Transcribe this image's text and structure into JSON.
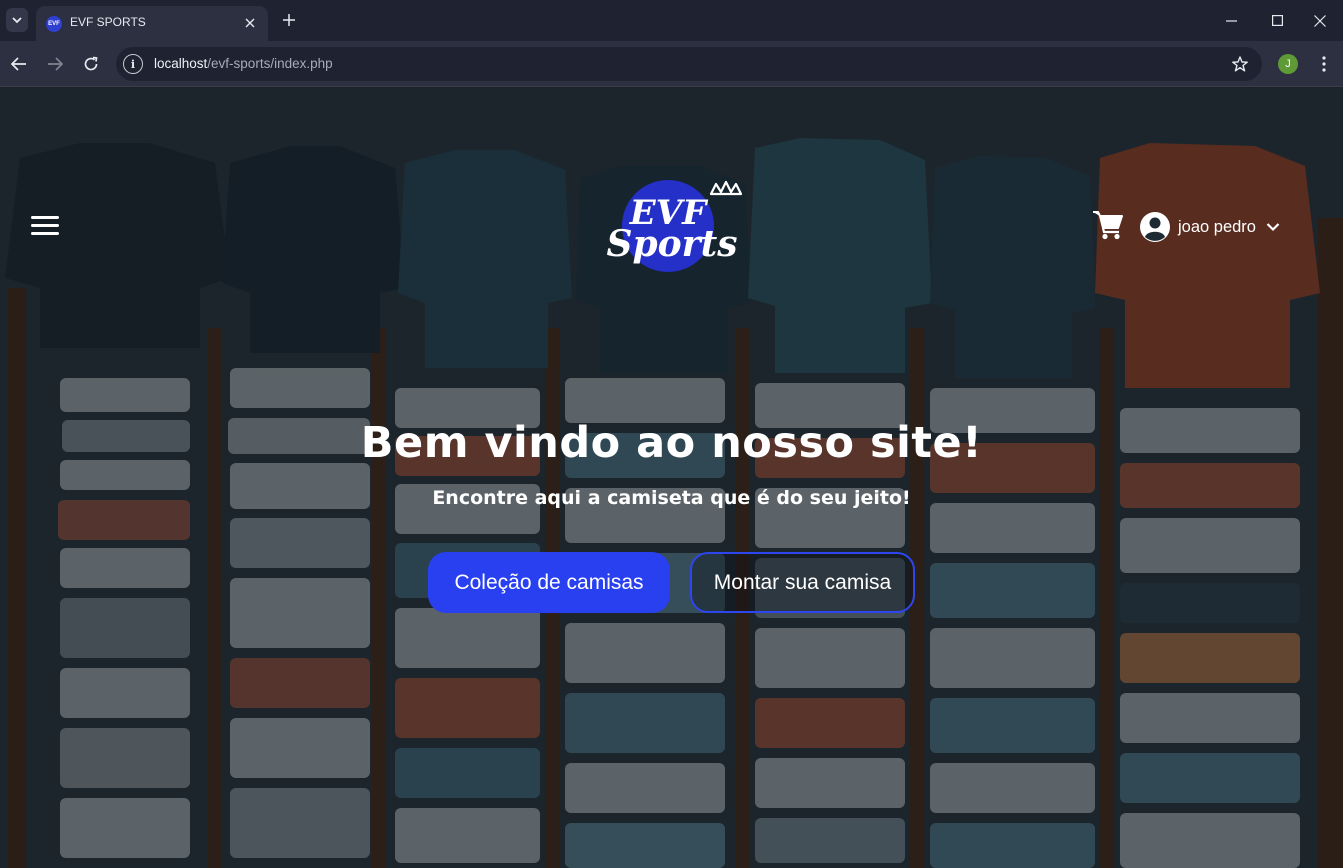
{
  "browser": {
    "tab_title": "EVF SPORTS",
    "favicon_text": "EVF",
    "url_host": "localhost",
    "url_path": "/evf-sports/index.php",
    "profile_initial": "J"
  },
  "header": {
    "logo_text_top": "EVF",
    "logo_text_bottom": "Sports",
    "user_name": "joao pedro"
  },
  "hero": {
    "title": "Bem vindo ao nosso site!",
    "subtitle": "Encontre aqui a camiseta que é do seu jeito!",
    "primary_button": "Coleção de camisas",
    "secondary_button": "Montar sua camisa"
  },
  "colors": {
    "accent": "#2840f0",
    "logo_circle": "#2530c8",
    "tab_bar": "#1f2230"
  }
}
